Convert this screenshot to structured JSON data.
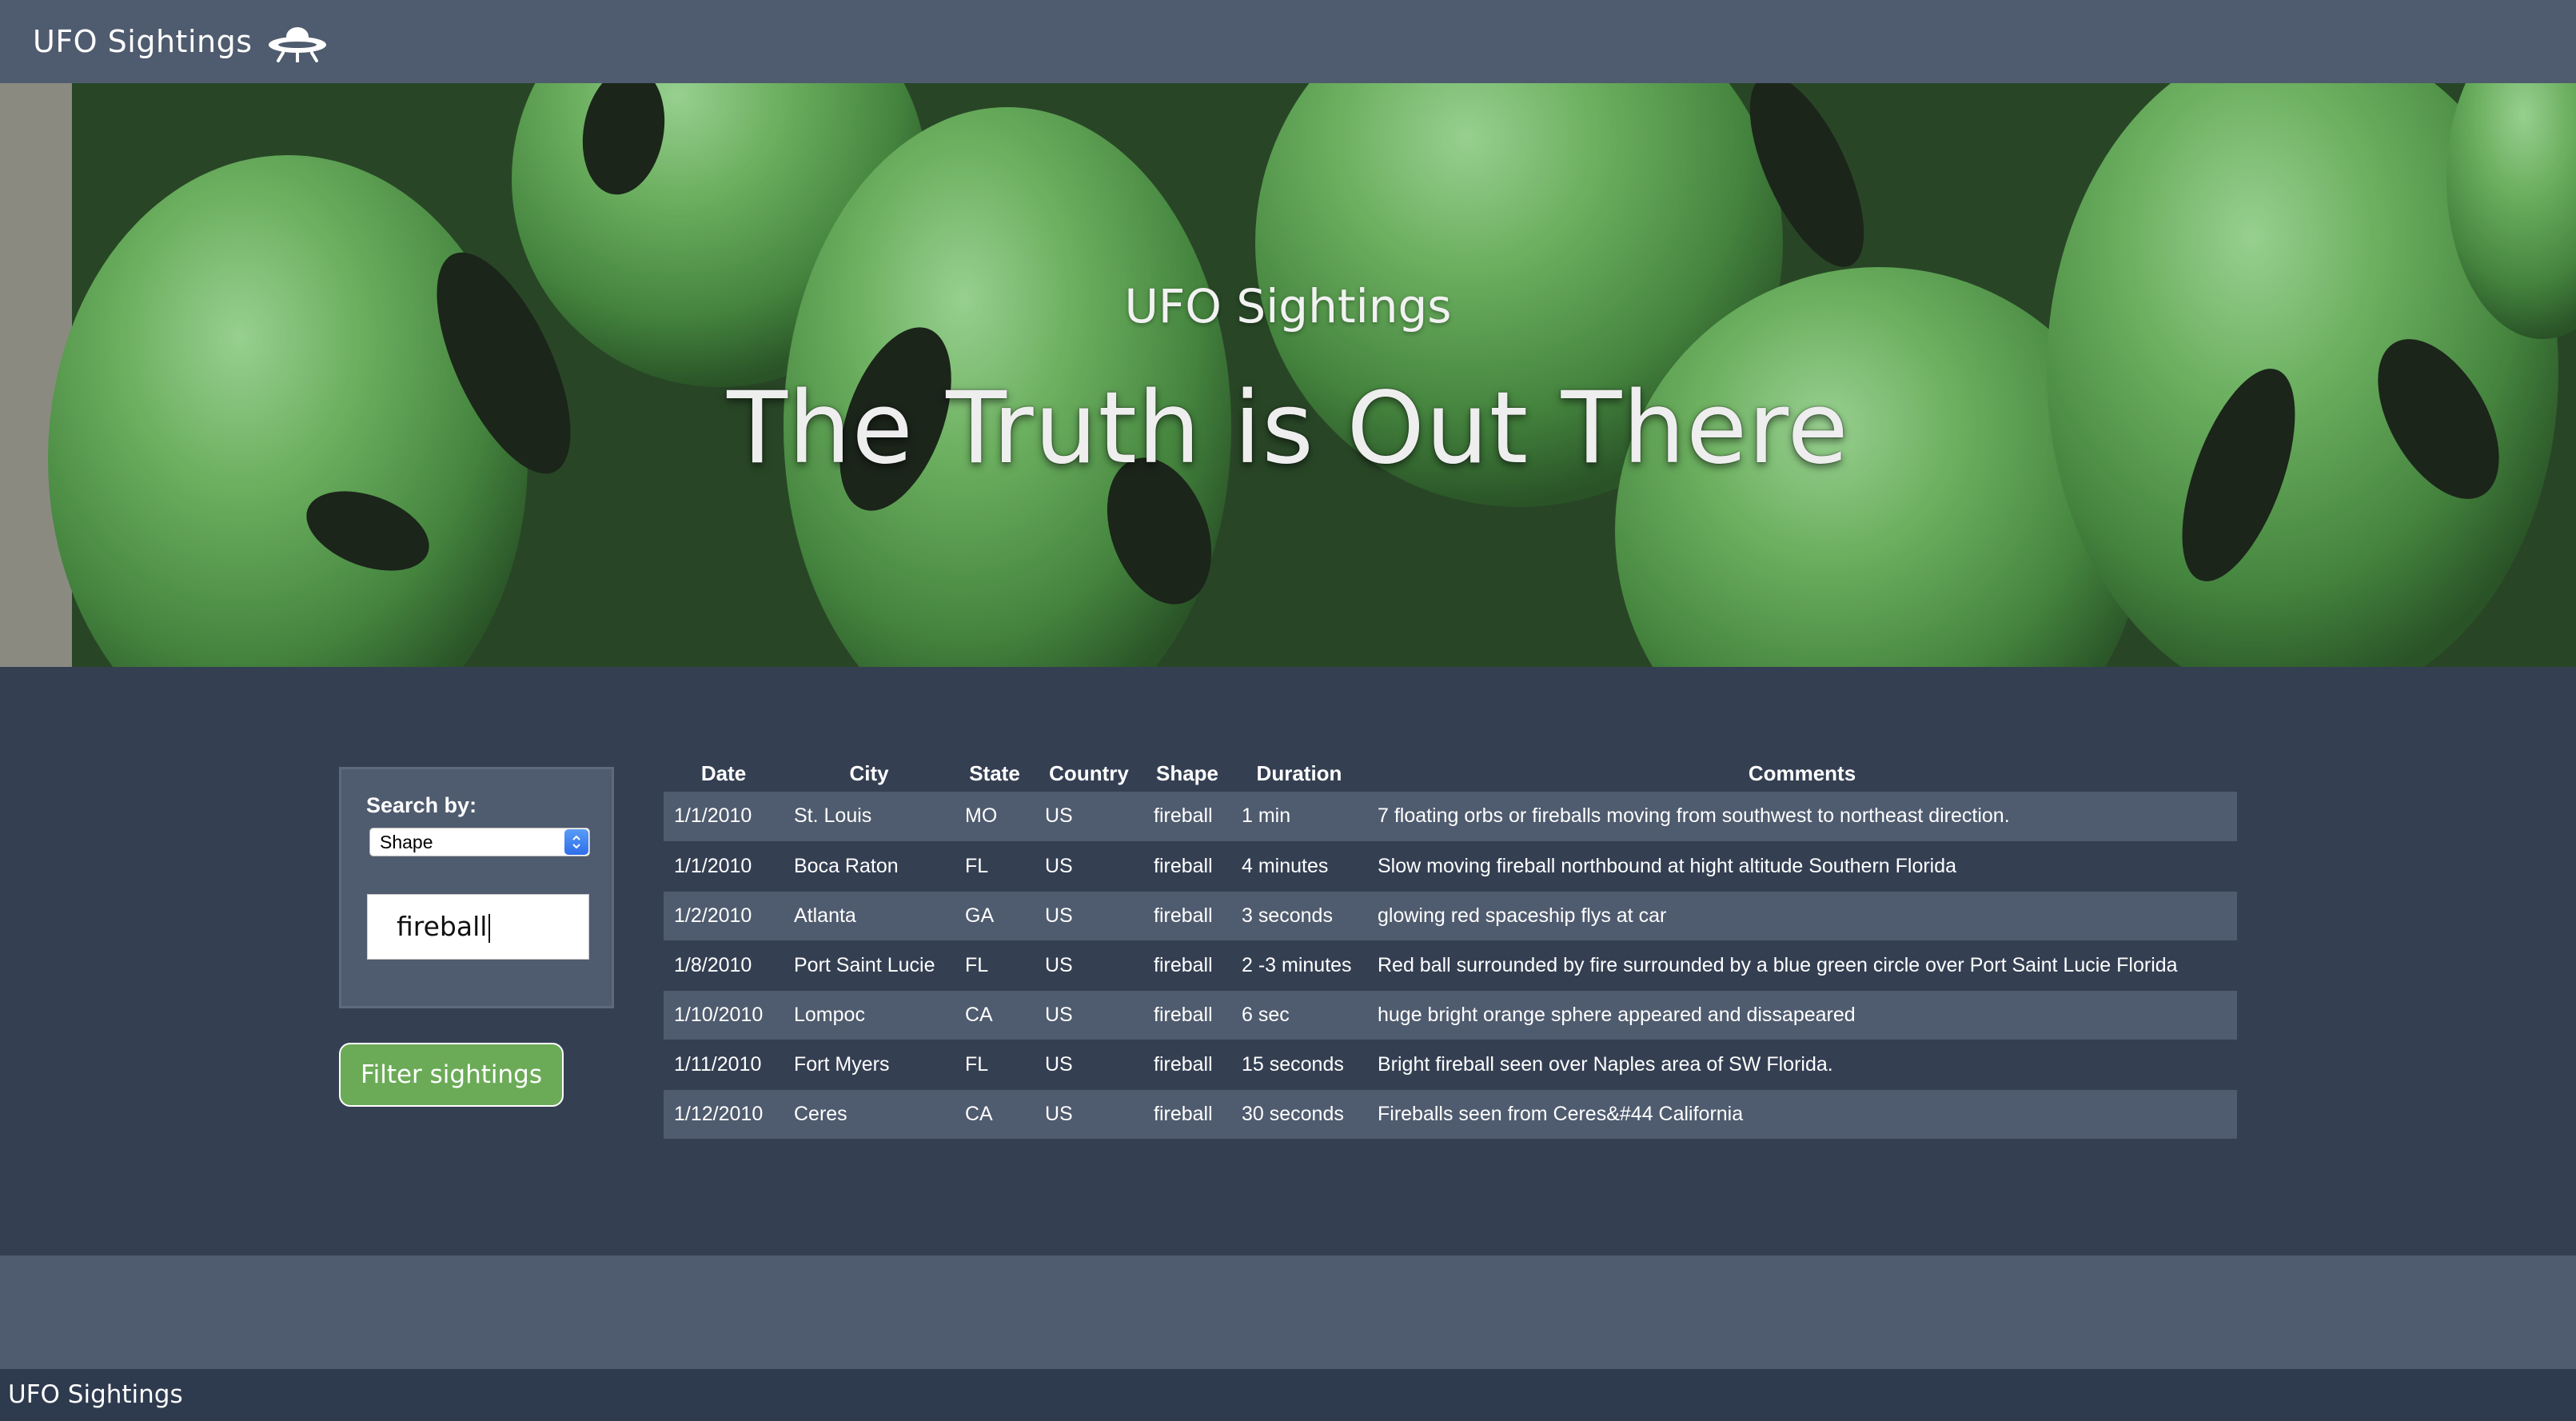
{
  "navbar": {
    "brand": "UFO Sightings",
    "icon": "ufo-icon"
  },
  "hero": {
    "subtitle": "UFO Sightings",
    "title": "The Truth is Out There",
    "background": "alien-heads-photo"
  },
  "filter": {
    "search_label": "Search by:",
    "select_value": "Shape",
    "input_value": "fireball",
    "button_label": "Filter sightings"
  },
  "table": {
    "headers": [
      "Date",
      "City",
      "State",
      "Country",
      "Shape",
      "Duration",
      "Comments"
    ],
    "rows": [
      [
        "1/1/2010",
        "St. Louis",
        "MO",
        "US",
        "fireball",
        "1 min",
        "7 floating orbs or fireballs moving from southwest to northeast direction."
      ],
      [
        "1/1/2010",
        "Boca Raton",
        "FL",
        "US",
        "fireball",
        "4 minutes",
        "Slow moving fireball northbound at hight altitude Southern Florida"
      ],
      [
        "1/2/2010",
        "Atlanta",
        "GA",
        "US",
        "fireball",
        "3 seconds",
        "glowing red spaceship flys at car"
      ],
      [
        "1/8/2010",
        "Port Saint Lucie",
        "FL",
        "US",
        "fireball",
        "2 -3 minutes",
        "Red ball surrounded by fire surrounded by a blue green circle over Port Saint Lucie Florida"
      ],
      [
        "1/10/2010",
        "Lompoc",
        "CA",
        "US",
        "fireball",
        "6 sec",
        "huge bright orange sphere appeared and dissapeared"
      ],
      [
        "1/11/2010",
        "Fort Myers",
        "FL",
        "US",
        "fireball",
        "15 seconds",
        "Bright fireball seen over Naples area of SW Florida."
      ],
      [
        "1/12/2010",
        "Ceres",
        "CA",
        "US",
        "fireball",
        "30 seconds",
        "Fireballs seen from Ceres&#44 California"
      ]
    ]
  },
  "footer": {
    "text": "UFO Sightings"
  },
  "colors": {
    "navbar": "#4f5b6e",
    "main_bg": "#343f52",
    "footer": "#2e3a4e",
    "button": "#6bab57"
  }
}
